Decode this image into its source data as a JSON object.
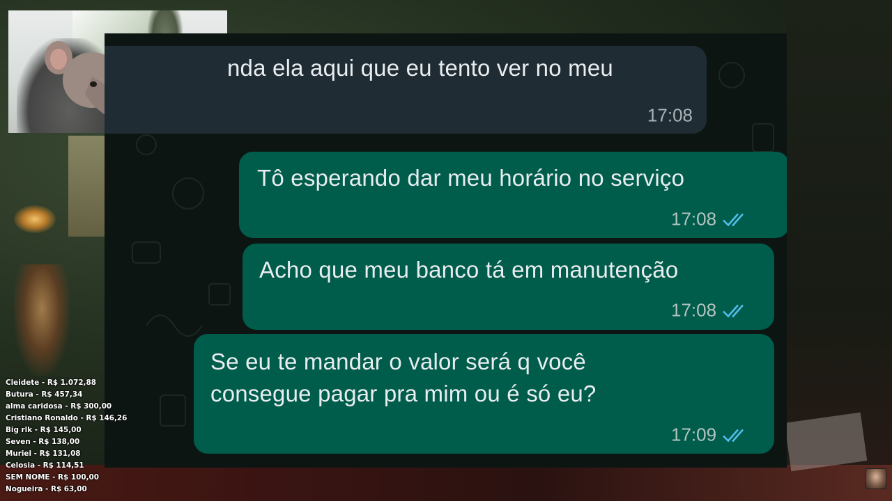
{
  "chat": {
    "messages": [
      {
        "direction": "incoming",
        "text": "nda ela aqui que eu tento ver no meu",
        "time": "17:08"
      },
      {
        "direction": "outgoing",
        "text": "Tô esperando dar meu horário no serviço",
        "time": "17:08",
        "status": "read"
      },
      {
        "direction": "outgoing",
        "text": "Acho que meu banco tá em manutenção",
        "time": "17:08",
        "status": "read"
      },
      {
        "direction": "outgoing",
        "line1": "Se eu te mandar o valor será q você",
        "line2": "consegue pagar pra mim ou é só eu?",
        "time": "17:09",
        "status": "read"
      }
    ],
    "colors": {
      "background": "#0d1512",
      "incoming_bubble": "#1f2c34",
      "outgoing_bubble": "#005c4b",
      "read_ticks": "#53bdeb"
    }
  },
  "donations": [
    "Cleidete - R$ 1.072,88",
    "Butura - R$ 457,34",
    "alma caridosa - R$ 300,00",
    "Cristiano Ronaldo - R$ 146,26",
    "Big rlk - R$ 145,00",
    "Seven - R$ 138,00",
    "Muriel - R$ 131,08",
    "Celosia - R$ 114,51",
    "SEM NOME - R$ 100,00",
    "Nogueira - R$ 63,00"
  ],
  "icons": {
    "read_receipt": "double-check-icon",
    "webcam": "webcam-feed",
    "avatar": "avatar"
  }
}
